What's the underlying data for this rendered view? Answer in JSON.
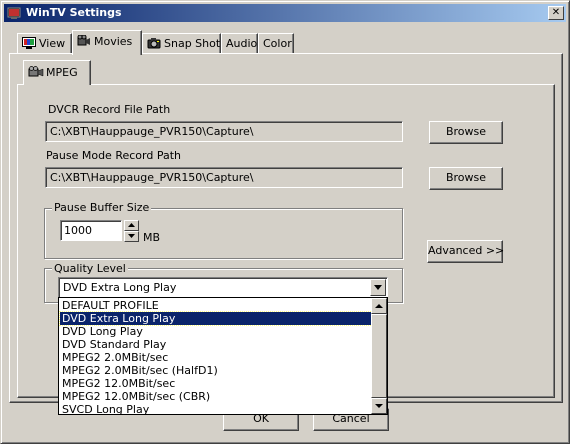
{
  "window": {
    "title": "WinTV Settings",
    "close_glyph": "✕",
    "icon": "wintv-app-icon"
  },
  "tabs": [
    {
      "label": "View",
      "icon": "tv-icon",
      "active": false
    },
    {
      "label": "Movies",
      "icon": "movie-camera-icon",
      "active": true
    },
    {
      "label": "Snap Shot",
      "icon": "camera-icon",
      "active": false
    },
    {
      "label": "Audio",
      "icon": "",
      "active": false
    },
    {
      "label": "Color",
      "icon": "",
      "active": false
    }
  ],
  "subtab": {
    "label": "MPEG",
    "icon": "film-camera-icon"
  },
  "dvcr": {
    "label": "DVCR Record File Path",
    "value": "C:\\XBT\\Hauppauge_PVR150\\Capture\\",
    "browse_label": "Browse"
  },
  "pause_path": {
    "label": "Pause Mode Record Path",
    "value": "C:\\XBT\\Hauppauge_PVR150\\Capture\\",
    "browse_label": "Browse"
  },
  "pause_buffer": {
    "title": "Pause Buffer Size",
    "value": "1000",
    "unit": "MB"
  },
  "advanced_label": "Advanced >>",
  "quality": {
    "title": "Quality Level",
    "selected": "DVD Extra Long Play",
    "options": [
      "DEFAULT PROFILE",
      "DVD Extra Long Play",
      "DVD Long Play",
      "DVD Standard Play",
      "MPEG2  2.0MBit/sec",
      "MPEG2  2.0MBit/sec (HalfD1)",
      "MPEG2 12.0MBit/sec",
      "MPEG2 12.0MBit/sec (CBR)",
      "SVCD Long Play"
    ]
  },
  "footer": {
    "ok_label": "OK",
    "cancel_label": "Cancel"
  },
  "colors": {
    "face": "#d4d0c8",
    "title_start": "#0a246a",
    "title_end": "#a6caf0",
    "selection": "#0a246a"
  }
}
